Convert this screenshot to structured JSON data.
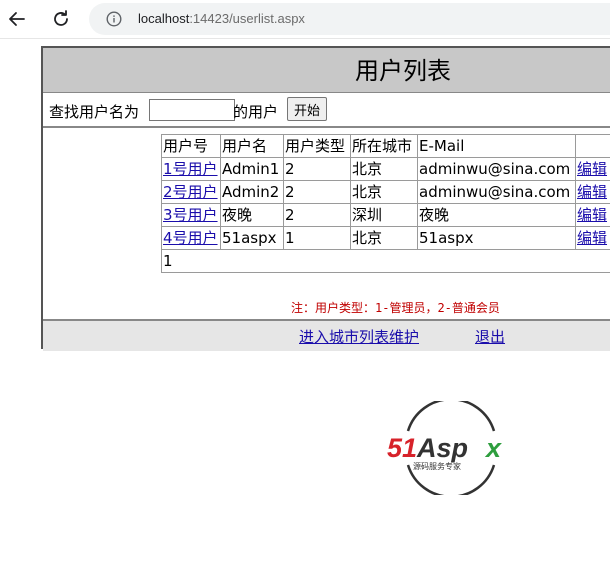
{
  "browser": {
    "url_host": "localhost",
    "url_rest": ":14423/userlist.aspx"
  },
  "page": {
    "title": "用户列表",
    "search": {
      "label_before": "查找用户名为",
      "input_value": "",
      "label_after": "的用户",
      "button_label": "开始"
    },
    "table": {
      "headers": [
        "用户号",
        "用户名",
        "用户类型",
        "所在城市",
        "E-Mail",
        ""
      ],
      "rows": [
        {
          "id_link": "1号用户",
          "username": "Admin1",
          "type": "2",
          "city": "北京",
          "email": "adminwu@sina.com",
          "edit": "编辑"
        },
        {
          "id_link": "2号用户",
          "username": "Admin2",
          "type": "2",
          "city": "北京",
          "email": "adminwu@sina.com",
          "edit": "编辑"
        },
        {
          "id_link": "3号用户",
          "username": "夜晚",
          "type": "2",
          "city": "深圳",
          "email": "夜晚",
          "edit": "编辑"
        },
        {
          "id_link": "4号用户",
          "username": "51aspx",
          "type": "1",
          "city": "北京",
          "email": "51aspx",
          "edit": "编辑"
        }
      ],
      "pager": "1"
    },
    "note": "注：用户类型：1-管理员，2-普通会员",
    "footer": {
      "city_link": "进入城市列表维护",
      "logout_link": "退出"
    }
  },
  "logo": {
    "brand": "51Aspx",
    "tagline": "源码服务专家",
    "colors": {
      "red": "#d7222a",
      "green": "#2e9e3e",
      "dark": "#333333"
    }
  }
}
